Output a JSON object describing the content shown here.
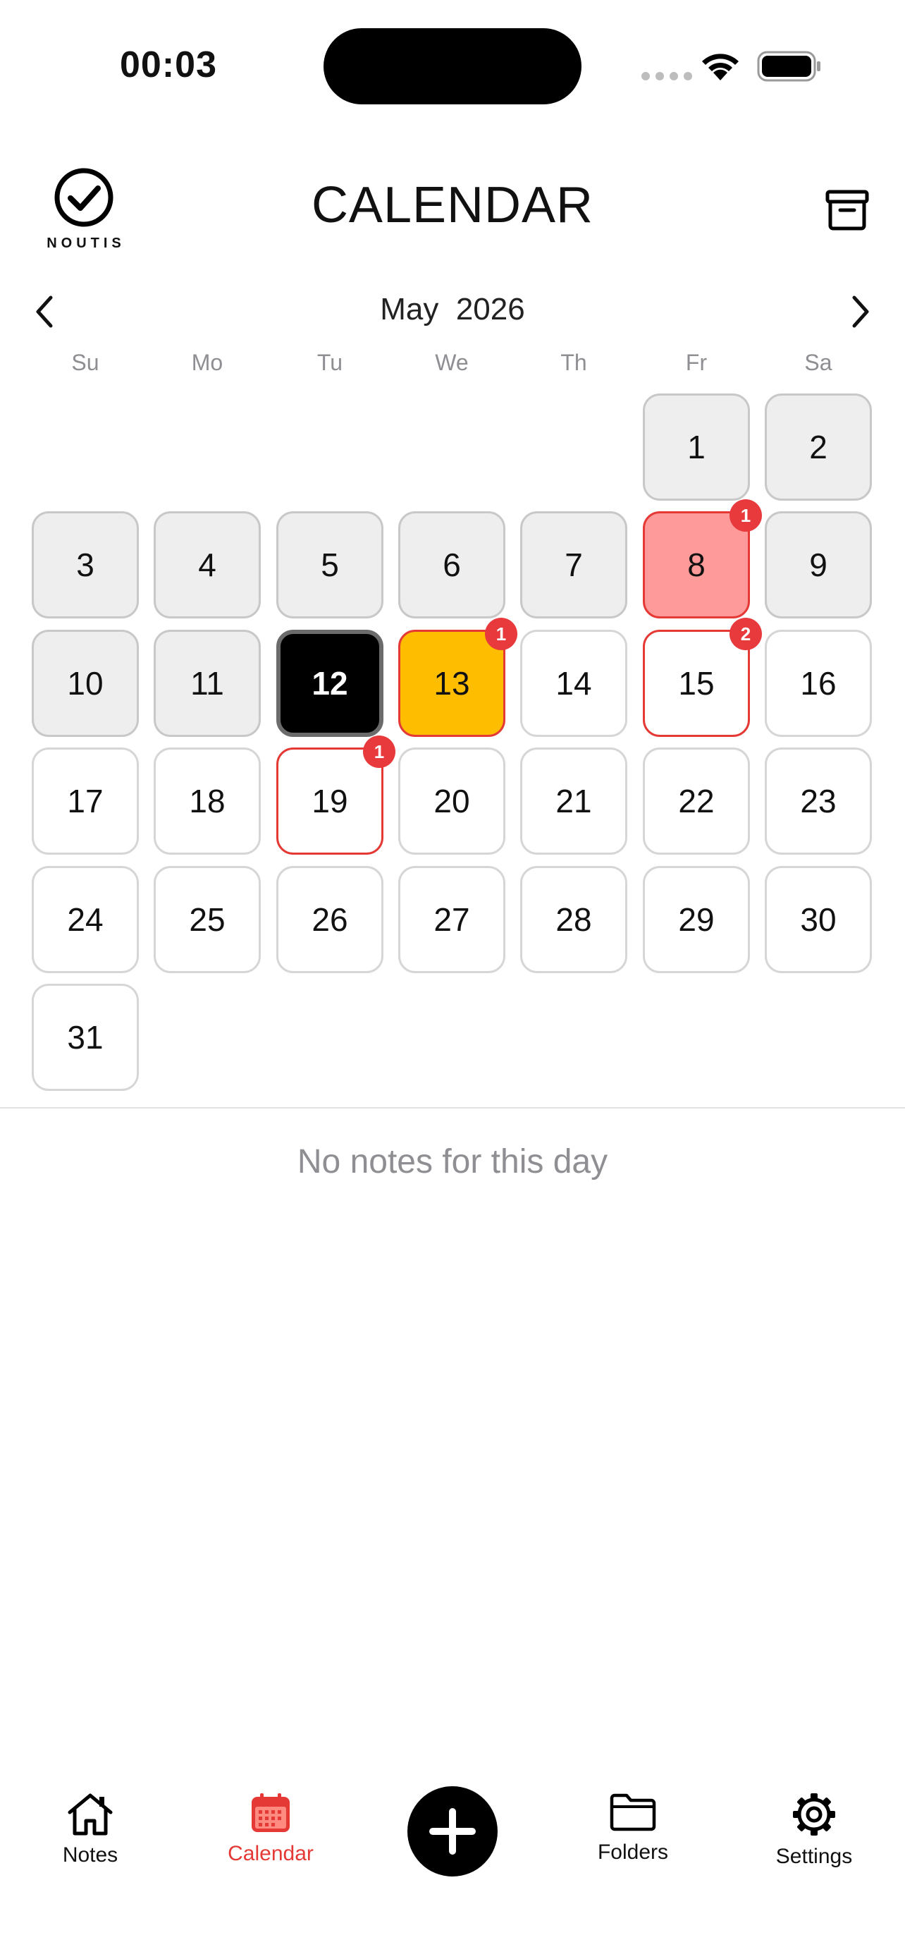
{
  "status_bar": {
    "time": "00:03"
  },
  "header": {
    "logo_text": "NOUTIS",
    "title": "CALENDAR"
  },
  "calendar": {
    "month": "May",
    "year": "2026",
    "month_label": "May  2026",
    "weekdays": [
      "Su",
      "Mo",
      "Tu",
      "We",
      "Th",
      "Fr",
      "Sa"
    ],
    "days": [
      {
        "label": "1",
        "col": 5,
        "row": 0,
        "state": "past"
      },
      {
        "label": "2",
        "col": 6,
        "row": 0,
        "state": "past"
      },
      {
        "label": "3",
        "col": 0,
        "row": 1,
        "state": "past"
      },
      {
        "label": "4",
        "col": 1,
        "row": 1,
        "state": "past"
      },
      {
        "label": "5",
        "col": 2,
        "row": 1,
        "state": "past"
      },
      {
        "label": "6",
        "col": 3,
        "row": 1,
        "state": "past"
      },
      {
        "label": "7",
        "col": 4,
        "row": 1,
        "state": "past"
      },
      {
        "label": "8",
        "col": 5,
        "row": 1,
        "state": "red-fill",
        "badge": "1"
      },
      {
        "label": "9",
        "col": 6,
        "row": 1,
        "state": "past"
      },
      {
        "label": "10",
        "col": 0,
        "row": 2,
        "state": "past"
      },
      {
        "label": "11",
        "col": 1,
        "row": 2,
        "state": "past"
      },
      {
        "label": "12",
        "col": 2,
        "row": 2,
        "state": "today"
      },
      {
        "label": "13",
        "col": 3,
        "row": 2,
        "state": "yellow-fill",
        "badge": "1"
      },
      {
        "label": "14",
        "col": 4,
        "row": 2,
        "state": "future"
      },
      {
        "label": "15",
        "col": 5,
        "row": 2,
        "state": "noted",
        "badge": "2"
      },
      {
        "label": "16",
        "col": 6,
        "row": 2,
        "state": "future"
      },
      {
        "label": "17",
        "col": 0,
        "row": 3,
        "state": "future"
      },
      {
        "label": "18",
        "col": 1,
        "row": 3,
        "state": "future"
      },
      {
        "label": "19",
        "col": 2,
        "row": 3,
        "state": "noted",
        "badge": "1"
      },
      {
        "label": "20",
        "col": 3,
        "row": 3,
        "state": "future"
      },
      {
        "label": "21",
        "col": 4,
        "row": 3,
        "state": "future"
      },
      {
        "label": "22",
        "col": 5,
        "row": 3,
        "state": "future"
      },
      {
        "label": "23",
        "col": 6,
        "row": 3,
        "state": "future"
      },
      {
        "label": "24",
        "col": 0,
        "row": 4,
        "state": "future"
      },
      {
        "label": "25",
        "col": 1,
        "row": 4,
        "state": "future"
      },
      {
        "label": "26",
        "col": 2,
        "row": 4,
        "state": "future"
      },
      {
        "label": "27",
        "col": 3,
        "row": 4,
        "state": "future"
      },
      {
        "label": "28",
        "col": 4,
        "row": 4,
        "state": "future"
      },
      {
        "label": "29",
        "col": 5,
        "row": 4,
        "state": "future"
      },
      {
        "label": "30",
        "col": 6,
        "row": 4,
        "state": "future"
      },
      {
        "label": "31",
        "col": 0,
        "row": 5,
        "state": "future"
      }
    ],
    "empty_message": "No notes for this day"
  },
  "colors": {
    "accent_red": "#e53935",
    "badge_red": "#e8393c",
    "highlight_pink": "#ff9a9a",
    "highlight_yellow": "#ffbd00",
    "past_gray": "#eeeeee"
  },
  "tab_bar": {
    "notes_label": "Notes",
    "calendar_label": "Calendar",
    "folders_label": "Folders",
    "settings_label": "Settings",
    "add_icon": "plus-icon"
  }
}
